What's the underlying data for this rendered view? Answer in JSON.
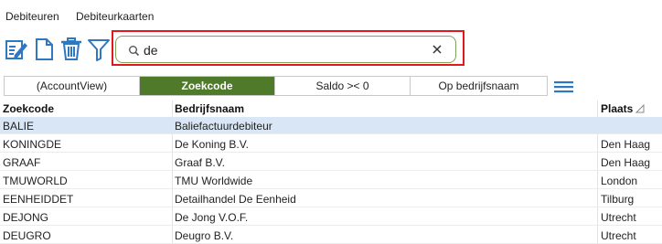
{
  "menu": {
    "items": [
      "Debiteuren",
      "Debiteurkaarten"
    ]
  },
  "toolbar": {
    "icons": [
      "edit-icon",
      "new-document-icon",
      "delete-icon",
      "filter-icon"
    ]
  },
  "search": {
    "value": "de",
    "placeholder": ""
  },
  "tabs": [
    {
      "label": "(AccountView)",
      "active": false
    },
    {
      "label": "Zoekcode",
      "active": true
    },
    {
      "label": "Saldo >< 0",
      "active": false
    },
    {
      "label": "Op bedrijfsnaam",
      "active": false
    }
  ],
  "grid": {
    "columns": [
      "Zoekcode",
      "Bedrijfsnaam",
      "Plaats"
    ],
    "rows": [
      {
        "zoekcode": "BALIE",
        "bedrijfsnaam": "Baliefactuurdebiteur",
        "plaats": "",
        "selected": true
      },
      {
        "zoekcode": "KONINGDE",
        "bedrijfsnaam": "De Koning B.V.",
        "plaats": "Den Haag",
        "selected": false
      },
      {
        "zoekcode": "GRAAF",
        "bedrijfsnaam": "Graaf B.V.",
        "plaats": "Den Haag",
        "selected": false
      },
      {
        "zoekcode": "TMUWORLD",
        "bedrijfsnaam": "TMU Worldwide",
        "plaats": "London",
        "selected": false
      },
      {
        "zoekcode": "EENHEIDDET",
        "bedrijfsnaam": "Detailhandel De Eenheid",
        "plaats": "Tilburg",
        "selected": false
      },
      {
        "zoekcode": "DEJONG",
        "bedrijfsnaam": "De Jong V.O.F.",
        "plaats": "Utrecht",
        "selected": false
      },
      {
        "zoekcode": "DEUGRO",
        "bedrijfsnaam": "Deugro B.V.",
        "plaats": "Utrecht",
        "selected": false
      }
    ]
  },
  "colors": {
    "accent_green": "#4f7a29",
    "icon_blue": "#2e78c2",
    "highlight_red": "#e1191d",
    "selected_row": "#d8e6f5"
  }
}
